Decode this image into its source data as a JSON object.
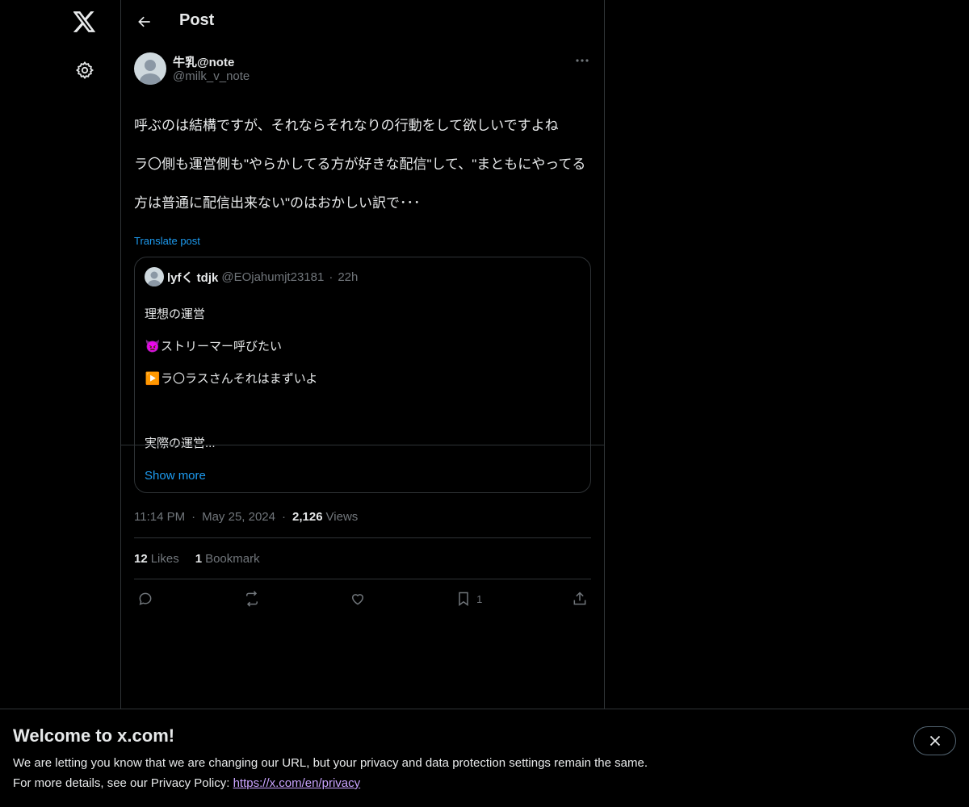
{
  "header": {
    "title": "Post"
  },
  "post": {
    "author_name": "牛乳@note",
    "author_handle": "@milk_v_note",
    "text_lines": [
      "呼ぶのは結構ですが、それならそれなりの行動をして欲しいですよね",
      "ラ〇側も運営側も\"やらかしてる方が好きな配信\"して、\"まともにやってる",
      "方は普通に配信出来ない\"のはおかしい訳で･･･"
    ],
    "translate_label": "Translate post",
    "time": "11:14 PM",
    "date": "May 25, 2024",
    "views_count": "2,126",
    "views_label": "Views",
    "likes_count": "12",
    "likes_label": "Likes",
    "bookmarks_count": "1",
    "bookmarks_label": "Bookmark",
    "action_bookmark_count": "1"
  },
  "quote": {
    "author_name": "lyfく tdjk",
    "author_handle": "@EOjahumjt23181",
    "time": "22h",
    "line1": "理想の運営",
    "line2_emoji": "👿",
    "line2_text": "ストリーマー呼びたい",
    "line3_emoji": "▶️",
    "line3_text": "ラ〇ラスさんそれはまずいよ",
    "line4": "",
    "line5": "実際の運営...",
    "show_more": "Show more"
  },
  "banner": {
    "title": "Welcome to x.com!",
    "line1": "We are letting you know that we are changing our URL, but your privacy and data protection settings remain the same.",
    "line2_prefix": "For more details, see our Privacy Policy: ",
    "link": "https://x.com/en/privacy"
  },
  "colors": {
    "accent": "#1d9bf0",
    "border": "#2f3336",
    "muted": "#71767b",
    "text": "#e7e9ea"
  }
}
